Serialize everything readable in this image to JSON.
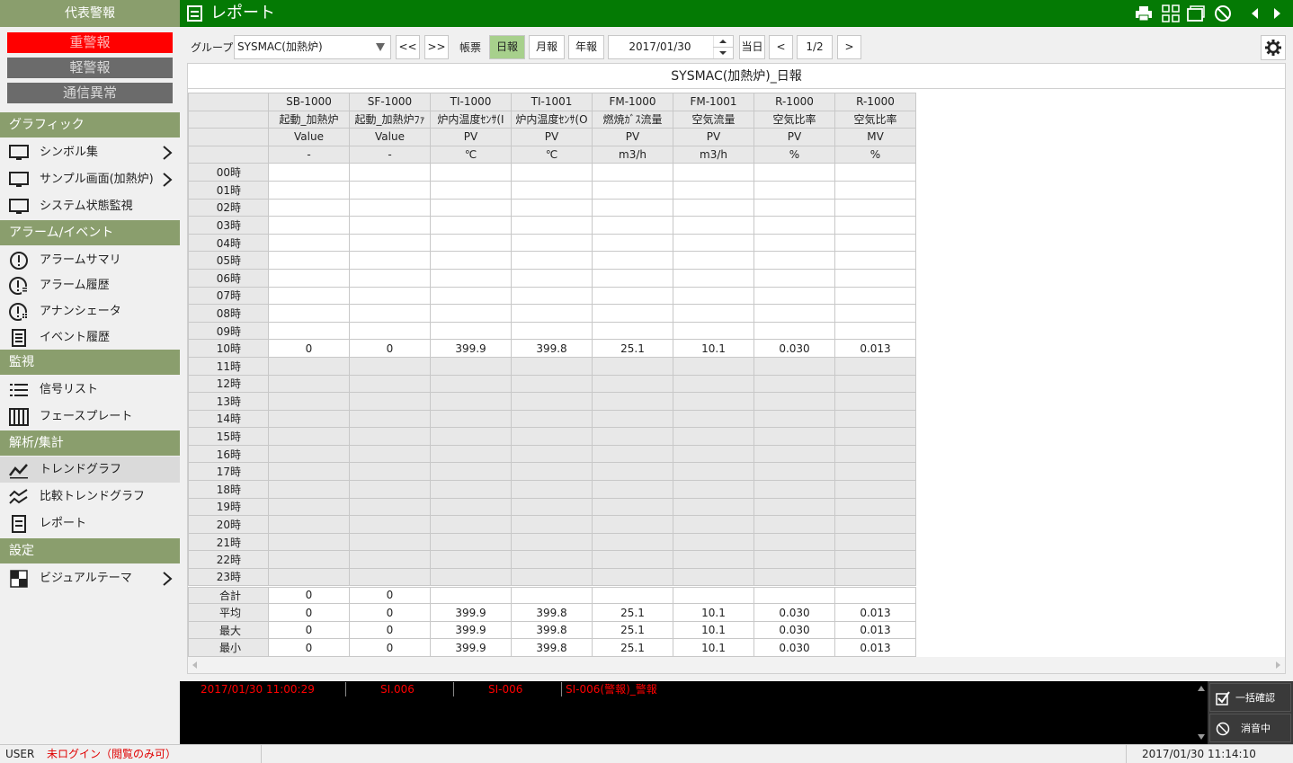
{
  "sidebar": {
    "title": "代表警報",
    "alarms": [
      "重警報",
      "軽警報",
      "通信異常"
    ],
    "sections": [
      {
        "label": "グラフィック",
        "items": [
          "シンボル集",
          "サンプル画面(加熱炉)",
          "システム状態監視"
        ]
      },
      {
        "label": "アラーム/イベント",
        "items": [
          "アラームサマリ",
          "アラーム履歴",
          "アナンシェータ",
          "イベント履歴"
        ]
      },
      {
        "label": "監視",
        "items": [
          "信号リスト",
          "フェースプレート"
        ]
      },
      {
        "label": "解析/集計",
        "items": [
          "トレンドグラフ",
          "比較トレンドグラフ",
          "レポート"
        ]
      },
      {
        "label": "設定",
        "items": [
          "ビジュアルテーマ"
        ]
      }
    ]
  },
  "topbar": {
    "title": "レポート"
  },
  "toolbar": {
    "group_label": "グループ",
    "group_value": "SYSMAC(加熱炉)",
    "prev_label": "<<",
    "next_label": ">>",
    "form_label": "帳票",
    "daily_label": "日報",
    "monthly_label": "月報",
    "yearly_label": "年報",
    "date_value": "2017/01/30",
    "today_label": "当日",
    "page_prev": "<",
    "page_value": "1/2",
    "page_next": ">"
  },
  "report": {
    "title": "SYSMAC(加熱炉)_日報",
    "columns": [
      {
        "tag": "SB-1000",
        "name": "起動_加熱炉",
        "type": "Value",
        "unit": "-"
      },
      {
        "tag": "SF-1000",
        "name": "起動_加熱炉ﾌｧ",
        "type": "Value",
        "unit": "-"
      },
      {
        "tag": "TI-1000",
        "name": "炉内温度ｾﾝｻ(I",
        "type": "PV",
        "unit": "℃"
      },
      {
        "tag": "TI-1001",
        "name": "炉内温度ｾﾝｻ(O",
        "type": "PV",
        "unit": "℃"
      },
      {
        "tag": "FM-1000",
        "name": "燃焼ｶﾞｽ流量",
        "type": "PV",
        "unit": "m3/h"
      },
      {
        "tag": "FM-1001",
        "name": "空気流量",
        "type": "PV",
        "unit": "m3/h"
      },
      {
        "tag": "R-1000",
        "name": "空気比率",
        "type": "PV",
        "unit": "%"
      },
      {
        "tag": "R-1000",
        "name": "空気比率",
        "type": "MV",
        "unit": "%"
      }
    ],
    "hours": [
      "00時",
      "01時",
      "02時",
      "03時",
      "04時",
      "05時",
      "06時",
      "07時",
      "08時",
      "09時",
      "10時",
      "11時",
      "12時",
      "13時",
      "14時",
      "15時",
      "16時",
      "17時",
      "18時",
      "19時",
      "20時",
      "21時",
      "22時",
      "23時"
    ],
    "row_10": [
      "0",
      "0",
      "399.9",
      "399.8",
      "25.1",
      "10.1",
      "0.030",
      "0.013"
    ],
    "summary": [
      {
        "label": "合計",
        "values": [
          "0",
          "0",
          "",
          "",
          "",
          "",
          "",
          ""
        ]
      },
      {
        "label": "平均",
        "values": [
          "0",
          "0",
          "399.9",
          "399.8",
          "25.1",
          "10.1",
          "0.030",
          "0.013"
        ]
      },
      {
        "label": "最大",
        "values": [
          "0",
          "0",
          "399.9",
          "399.8",
          "25.1",
          "10.1",
          "0.030",
          "0.013"
        ]
      },
      {
        "label": "最小",
        "values": [
          "0",
          "0",
          "399.9",
          "399.8",
          "25.1",
          "10.1",
          "0.030",
          "0.013"
        ]
      }
    ]
  },
  "alarm_bar": {
    "time": "2017/01/30 11:00:29",
    "code": "SI.006",
    "tag": "SI-006",
    "message": "SI-006(警報)_警報",
    "ack_all_label": "一括確認",
    "silence_label": "消音中"
  },
  "status": {
    "user_label": "USER",
    "user_value": "未ログイン（閲覧のみ可）",
    "datetime": "2017/01/30 11:14:10"
  },
  "colors": {
    "topbar": "#047a04",
    "section": "#8a9e6d",
    "heavy_alarm": "#ff0000",
    "active_form": "#a7d08c"
  }
}
